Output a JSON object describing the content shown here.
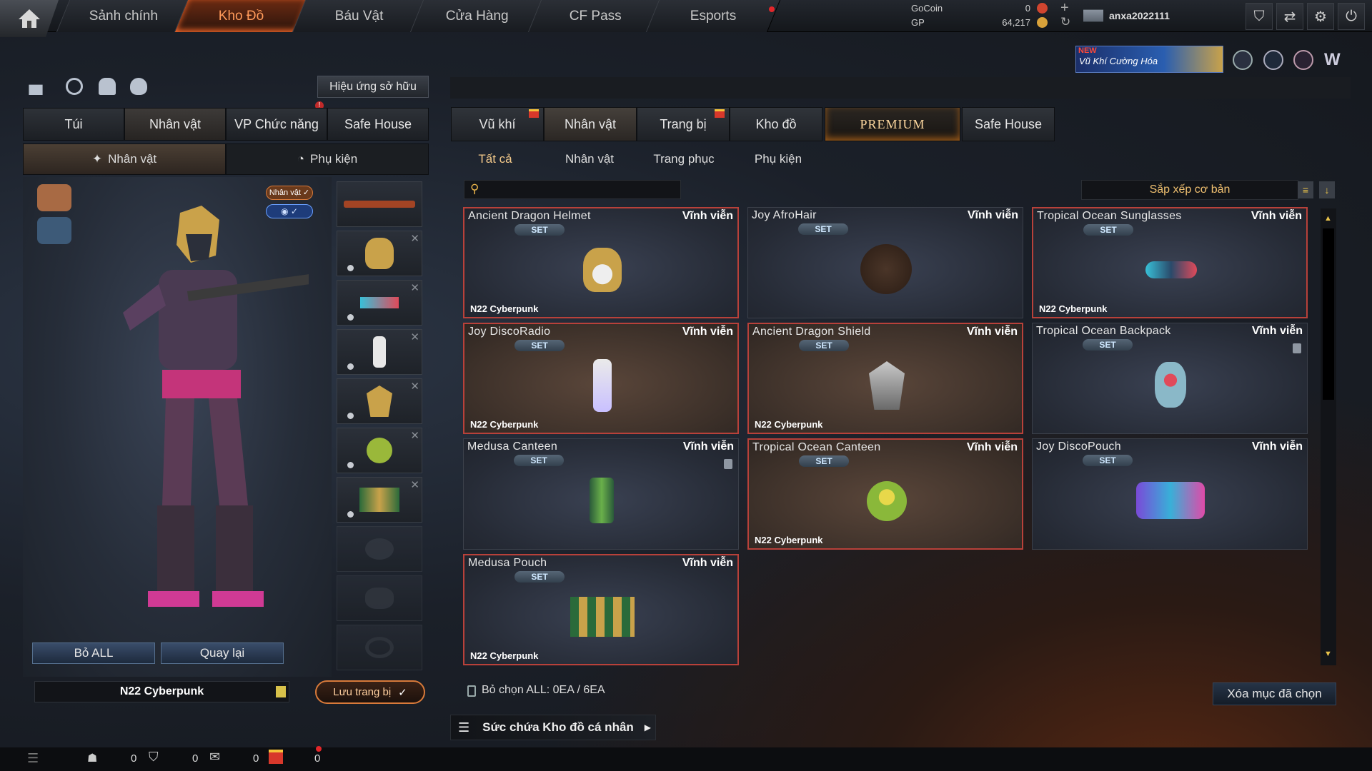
{
  "nav": {
    "tabs": [
      "Sảnh chính",
      "Kho Đồ",
      "Báu Vật",
      "Cửa Hàng",
      "CF Pass",
      "Esports"
    ],
    "active_tab": "Kho Đồ"
  },
  "currency": {
    "gocoin_label": "GoCoin",
    "gocoin_value": "0",
    "gp_label": "GP",
    "gp_value": "64,217"
  },
  "user": {
    "name": "anxa2022111"
  },
  "promo": {
    "new_label": "NEW",
    "text": "Vũ Khí Cường Hóa"
  },
  "left": {
    "effects_button": "Hiệu ứng sở hữu",
    "tabs": [
      "Túi",
      "Nhân vật",
      "VP Chức năng",
      "Safe House"
    ],
    "subtabs": [
      "Nhân vật",
      "Phụ kiện"
    ],
    "badge_label": "Nhân vật",
    "remove_all": "Bỏ ALL",
    "back": "Quay lại",
    "preset_name": "N22 Cyberpunk",
    "save_button": "Lưu trang bị"
  },
  "right": {
    "tabs": [
      "Vũ khí",
      "Nhân vật",
      "Trang bị",
      "Kho đồ",
      "PREMIUM",
      "Safe House"
    ],
    "subtabs": [
      "Tất cả",
      "Nhân vật",
      "Trang phục",
      "Phụ kiện"
    ],
    "search_placeholder": "",
    "sort_label": "Sắp xếp cơ bản",
    "deselect_label": "Bỏ chọn ALL: 0EA / 6EA",
    "delete_selected": "Xóa mục đã chọn",
    "storage_label": "Sức chứa Kho đồ cá nhân"
  },
  "items": [
    {
      "name": "Ancient Dragon Helmet",
      "duration": "Vĩnh viễn",
      "set": "SET",
      "tag": "N22 Cyberpunk",
      "icon": "dragon-helmet-icon"
    },
    {
      "name": "Joy AfroHair",
      "duration": "Vĩnh viễn",
      "set": "SET",
      "tag": "",
      "icon": "afro-hair-icon"
    },
    {
      "name": "Tropical Ocean Sunglasses",
      "duration": "Vĩnh viễn",
      "set": "SET",
      "tag": "N22 Cyberpunk",
      "icon": "sunglasses-icon"
    },
    {
      "name": "Joy DiscoRadio",
      "duration": "Vĩnh viễn",
      "set": "SET",
      "tag": "N22 Cyberpunk",
      "icon": "radio-icon"
    },
    {
      "name": "Ancient Dragon Shield",
      "duration": "Vĩnh viễn",
      "set": "SET",
      "tag": "N22 Cyberpunk",
      "icon": "dragon-shield-icon"
    },
    {
      "name": "Tropical Ocean Backpack",
      "duration": "Vĩnh viễn",
      "set": "SET",
      "tag": "",
      "icon": "backpack-icon"
    },
    {
      "name": "Medusa Canteen",
      "duration": "Vĩnh viễn",
      "set": "SET",
      "tag": "",
      "icon": "canteen-icon"
    },
    {
      "name": "Tropical Ocean Canteen",
      "duration": "Vĩnh viễn",
      "set": "SET",
      "tag": "N22 Cyberpunk",
      "icon": "coconut-icon"
    },
    {
      "name": "Joy DiscoPouch",
      "duration": "Vĩnh viễn",
      "set": "SET",
      "tag": "",
      "icon": "disco-pouch-icon"
    },
    {
      "name": "Medusa Pouch",
      "duration": "Vĩnh viễn",
      "set": "SET",
      "tag": "N22 Cyberpunk",
      "icon": "pouch-icon"
    }
  ],
  "bottom": {
    "count1": "0",
    "count2": "0",
    "count3": "0",
    "count4": "0"
  },
  "colors": {
    "accent": "#ff7a30",
    "card_border_red": "#b8413a",
    "tag_blue": "#56708f"
  }
}
